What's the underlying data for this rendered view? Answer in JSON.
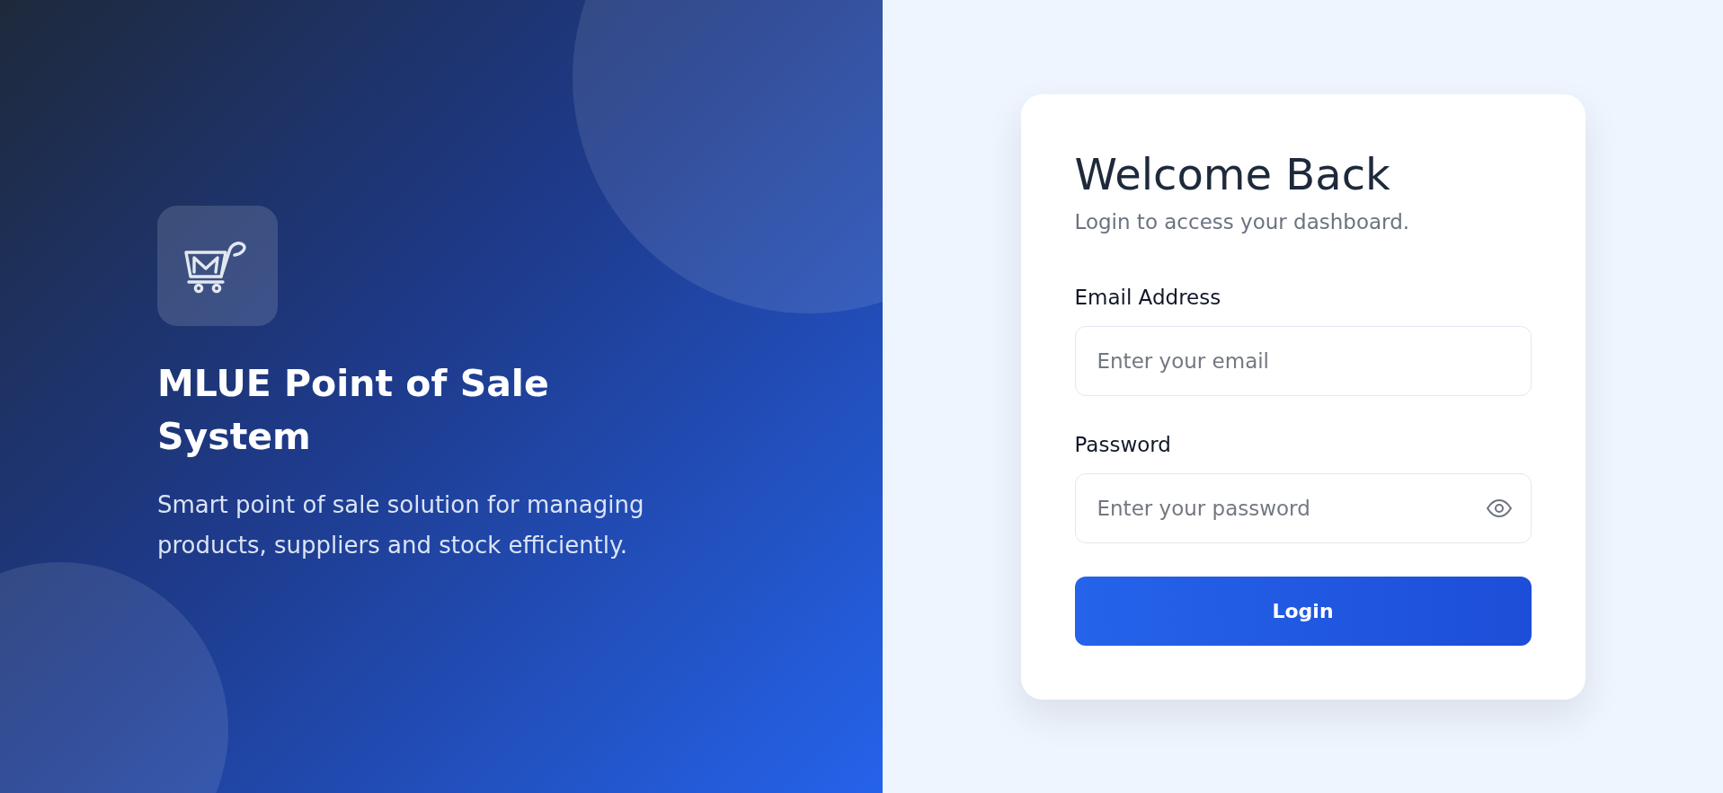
{
  "brand": {
    "title": "MLUE Point of Sale System",
    "tagline": "Smart point of sale solution for managing products, suppliers and stock efficiently."
  },
  "login_card": {
    "title": "Welcome Back",
    "subtitle": "Login to access your dashboard.",
    "fields": [
      {
        "label": "Email Address",
        "placeholder": "Enter your email",
        "reveal_toggle": false
      },
      {
        "label": "Password",
        "placeholder": "Enter your password",
        "reveal_toggle": true
      }
    ],
    "submit": {
      "label": "Login"
    }
  }
}
